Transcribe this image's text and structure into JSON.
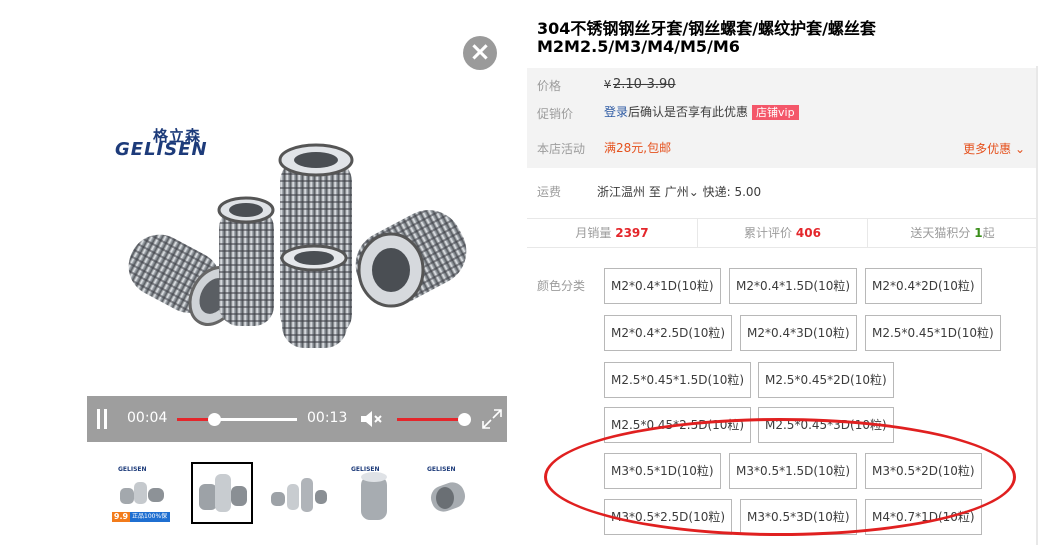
{
  "product": {
    "title_line1": "304不锈钢钢丝牙套/钢丝螺套/螺纹护套/螺丝套",
    "title_line2": "M2M2.5/M3/M4/M5/M6"
  },
  "brand": {
    "cn": "格立森",
    "en": "GELISEN"
  },
  "video": {
    "current_time": "00:04",
    "duration": "00:13",
    "progress": 0.31,
    "volume": 0.95
  },
  "thumbnails": [
    {
      "name": "thumb-1",
      "promo_price": "9.9",
      "promo_text": "正品100%保证"
    },
    {
      "name": "thumb-2",
      "active": true
    },
    {
      "name": "thumb-3"
    },
    {
      "name": "thumb-4"
    },
    {
      "name": "thumb-5"
    }
  ],
  "price": {
    "label": "价格",
    "currency": "¥",
    "range": "2.10-3.90"
  },
  "promo": {
    "label": "促销价",
    "login_text": "登录",
    "desc": "后确认是否享有此优惠",
    "vip_badge": "店铺vip"
  },
  "activity": {
    "label": "本店活动",
    "text": "满28元,包邮",
    "more": "更多优惠"
  },
  "shipping": {
    "label": "运费",
    "from": "浙江温州",
    "to_label": "至",
    "to": "广州",
    "express": "快递: 5.00"
  },
  "stats": [
    {
      "label": "月销量",
      "value": "2397"
    },
    {
      "label": "累计评价",
      "value": "406"
    },
    {
      "label": "送天猫积分",
      "value": "1",
      "suffix": "起"
    }
  ],
  "sku": {
    "label": "颜色分类",
    "options": [
      "M2*0.4*1D(10粒)",
      "M2*0.4*1.5D(10粒)",
      "M2*0.4*2D(10粒)",
      "M2*0.4*2.5D(10粒)",
      "M2*0.4*3D(10粒)",
      "M2.5*0.45*1D(10粒)",
      "M2.5*0.45*1.5D(10粒)",
      "M2.5*0.45*2D(10粒)",
      "M2.5*0.45*2.5D(10粒)",
      "M2.5*0.45*3D(10粒)",
      "M3*0.5*1D(10粒)",
      "M3*0.5*1.5D(10粒)",
      "M3*0.5*2D(10粒)",
      "M3*0.5*2.5D(10粒)",
      "M3*0.5*3D(10粒)",
      "M4*0.7*1D(10粒)"
    ]
  },
  "colors": {
    "accent_red": "#e4262b",
    "orange": "#e5511d",
    "annotation_circle": "#e02020"
  }
}
